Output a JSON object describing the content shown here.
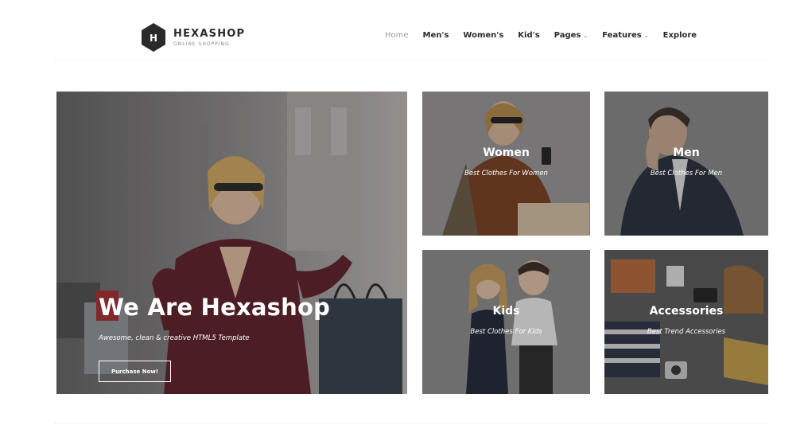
{
  "brand": {
    "name": "HEXASHOP",
    "tagline": "ONLINE SHOPPING",
    "mark": "H"
  },
  "nav": {
    "items": [
      {
        "label": "Home",
        "active": true
      },
      {
        "label": "Men's"
      },
      {
        "label": "Women's"
      },
      {
        "label": "Kid's"
      },
      {
        "label": "Pages",
        "dropdown": true
      },
      {
        "label": "Features",
        "dropdown": true
      },
      {
        "label": "Explore"
      }
    ],
    "dropdown_icon": "chevron-down-icon"
  },
  "hero": {
    "title": "We Are Hexashop",
    "subtitle": "Awesome, clean & creative HTML5 Template",
    "button_label": "Purchase Now!"
  },
  "categories": [
    {
      "title": "Women",
      "subtitle": "Best Clothes For Women"
    },
    {
      "title": "Men",
      "subtitle": "Best Clothes For Men"
    },
    {
      "title": "Kids",
      "subtitle": "Best Clothes For Kids"
    },
    {
      "title": "Accessories",
      "subtitle": "Best Trend Accessories"
    }
  ],
  "colors": {
    "text_dark": "#2a2a2a",
    "nav_active": "#a0a0a0",
    "overlay_text": "#ffffff"
  }
}
